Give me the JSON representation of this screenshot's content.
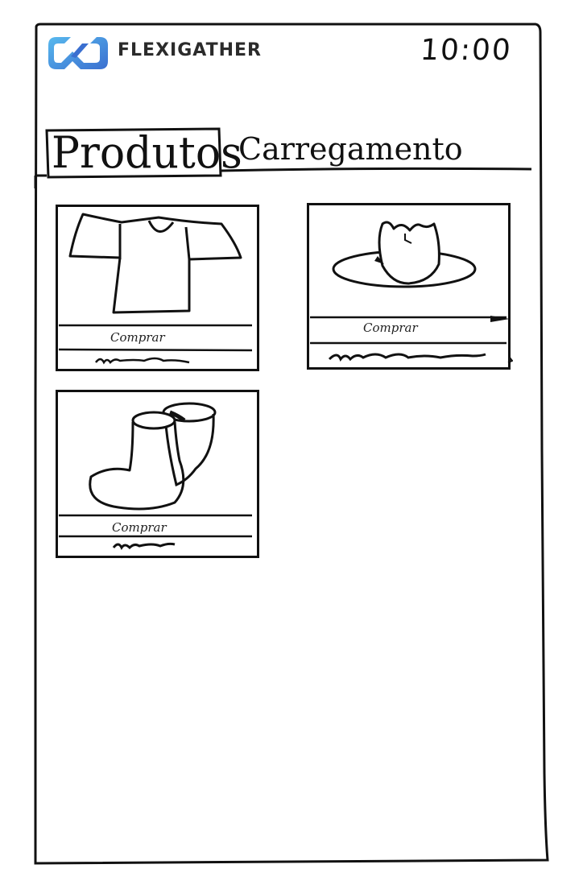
{
  "app": {
    "brand_name": "FLEXIGATHER",
    "time": "10:00"
  },
  "tabs": [
    {
      "label": "Produtos",
      "active": true
    },
    {
      "label": "Carregamento",
      "active": false
    }
  ],
  "products": [
    {
      "name": "t-shirt",
      "icon": "t-shirt-icon",
      "buy_label": "Comprar"
    },
    {
      "name": "hat",
      "icon": "hat-icon",
      "buy_label": "Comprar"
    },
    {
      "name": "boots",
      "icon": "boots-icon",
      "buy_label": "Comprar"
    }
  ],
  "colors": {
    "brand_logo_light": "#58b9ee",
    "brand_logo_dark": "#3a6fd0",
    "ink": "#111111"
  }
}
